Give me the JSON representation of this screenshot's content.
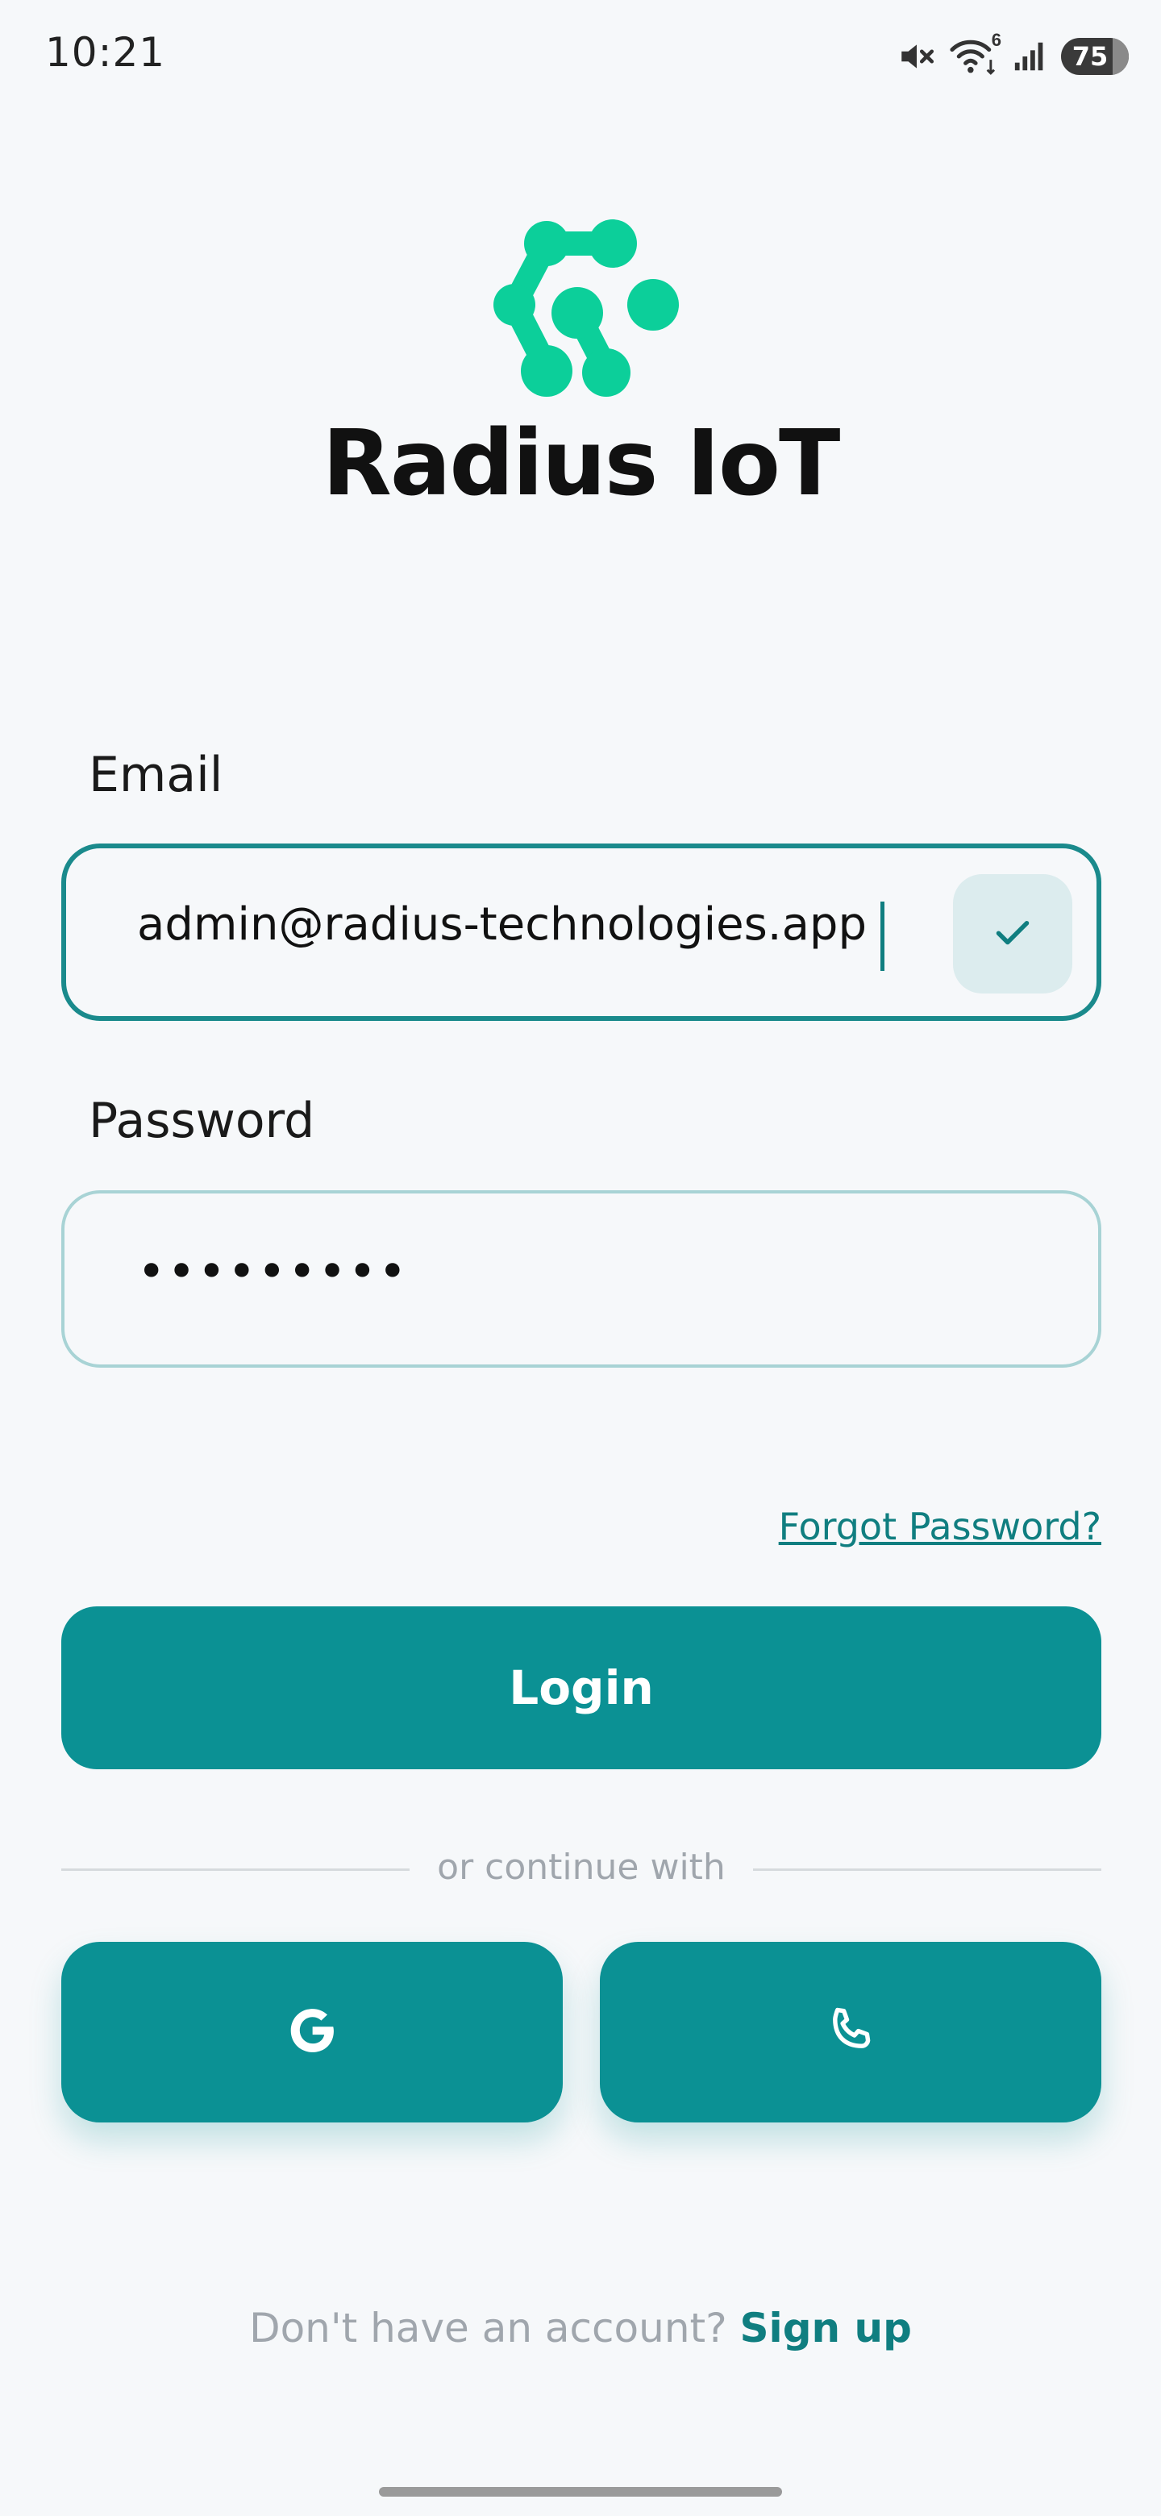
{
  "status_bar": {
    "time": "10:21",
    "wifi_badge": "6",
    "battery_level": "75"
  },
  "brand": {
    "name": "Radius IoT",
    "logo_color": "#0ccf9a"
  },
  "form": {
    "email_label": "Email",
    "email_value": "admin@radius-technologies.app",
    "email_valid": true,
    "password_label": "Password",
    "password_masked": "•••••••••",
    "forgot_password_label": "Forgot Password?"
  },
  "actions": {
    "login_label": "Login",
    "divider_text": "or continue with",
    "social": [
      {
        "name": "google",
        "icon": "google-icon"
      },
      {
        "name": "phone",
        "icon": "phone-icon"
      }
    ]
  },
  "footer": {
    "signup_prompt": "Don't have an account?",
    "signup_link": "Sign up"
  },
  "colors": {
    "accent": "#0b9194",
    "accent_dark": "#107e80",
    "background": "#f6f8fa",
    "muted_text": "#a0a6ad"
  }
}
